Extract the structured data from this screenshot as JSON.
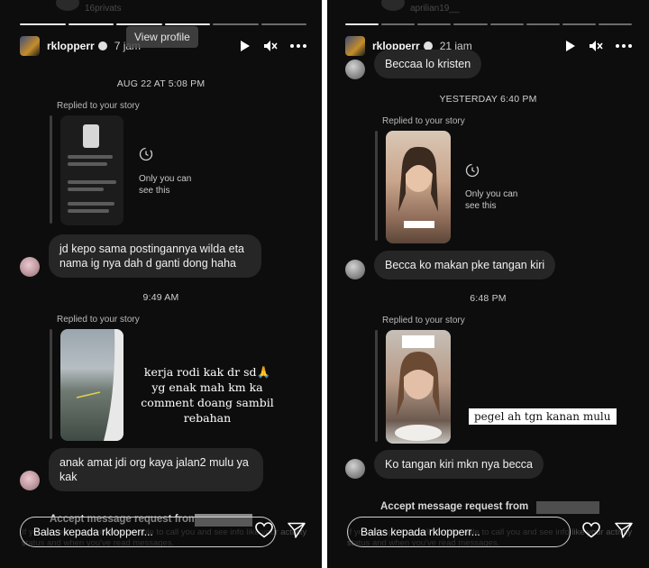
{
  "left": {
    "ghost_top": "16privats",
    "header": {
      "username": "rklopperr",
      "time": "7 jam"
    },
    "view_profile": "View profile",
    "stamp1": "AUG 22 AT 5:08 PM",
    "replied1": "Replied to your story",
    "only_you": "Only you can see this",
    "msg1": "jd kepo sama postingannya wilda eta nama ig nya dah d ganti dong haha",
    "stamp2": "9:49 AM",
    "replied2": "Replied to your story",
    "story_caption": "kerja rodi kak dr sd🙏 yg enak mah km ka comment doang sambil rebahan",
    "msg2": "anak amat jdi org kaya jalan2 mulu ya kak",
    "accept": "Accept message request from",
    "ghost_text": "If you accept, they will also be able to call you and see info like your activity status and when you've read messages.",
    "reply_placeholder": "Balas kepada rklopperr..."
  },
  "right": {
    "ghost_top": "aprilian19__",
    "header": {
      "username": "rklopperr",
      "time": "21 jam"
    },
    "msg0": "Beccaa lo kristen",
    "stamp1": "YESTERDAY 6:40 PM",
    "replied1": "Replied to your story",
    "only_you": "Only you can see this",
    "msg1": "Becca ko makan pke tangan kiri",
    "stamp2": "6:48 PM",
    "replied2": "Replied to your story",
    "story_caption": "pegel ah tgn kanan mulu",
    "msg2": "Ko tangan kiri mkn nya becca",
    "accept": "Accept message request from",
    "ghost_text": "If you accept, they will also be able to call you and see info like your activity status and when you've read messages.",
    "reply_placeholder": "Balas kepada rklopperr..."
  },
  "icons": [
    "play-icon",
    "mute-icon",
    "more-icon",
    "history-icon",
    "heart-icon",
    "send-icon",
    "verified-icon"
  ],
  "colors": {
    "background": "#0d0d0d",
    "bubble": "#262626",
    "text": "#f0f0f0",
    "muted": "#b9b9b9"
  }
}
